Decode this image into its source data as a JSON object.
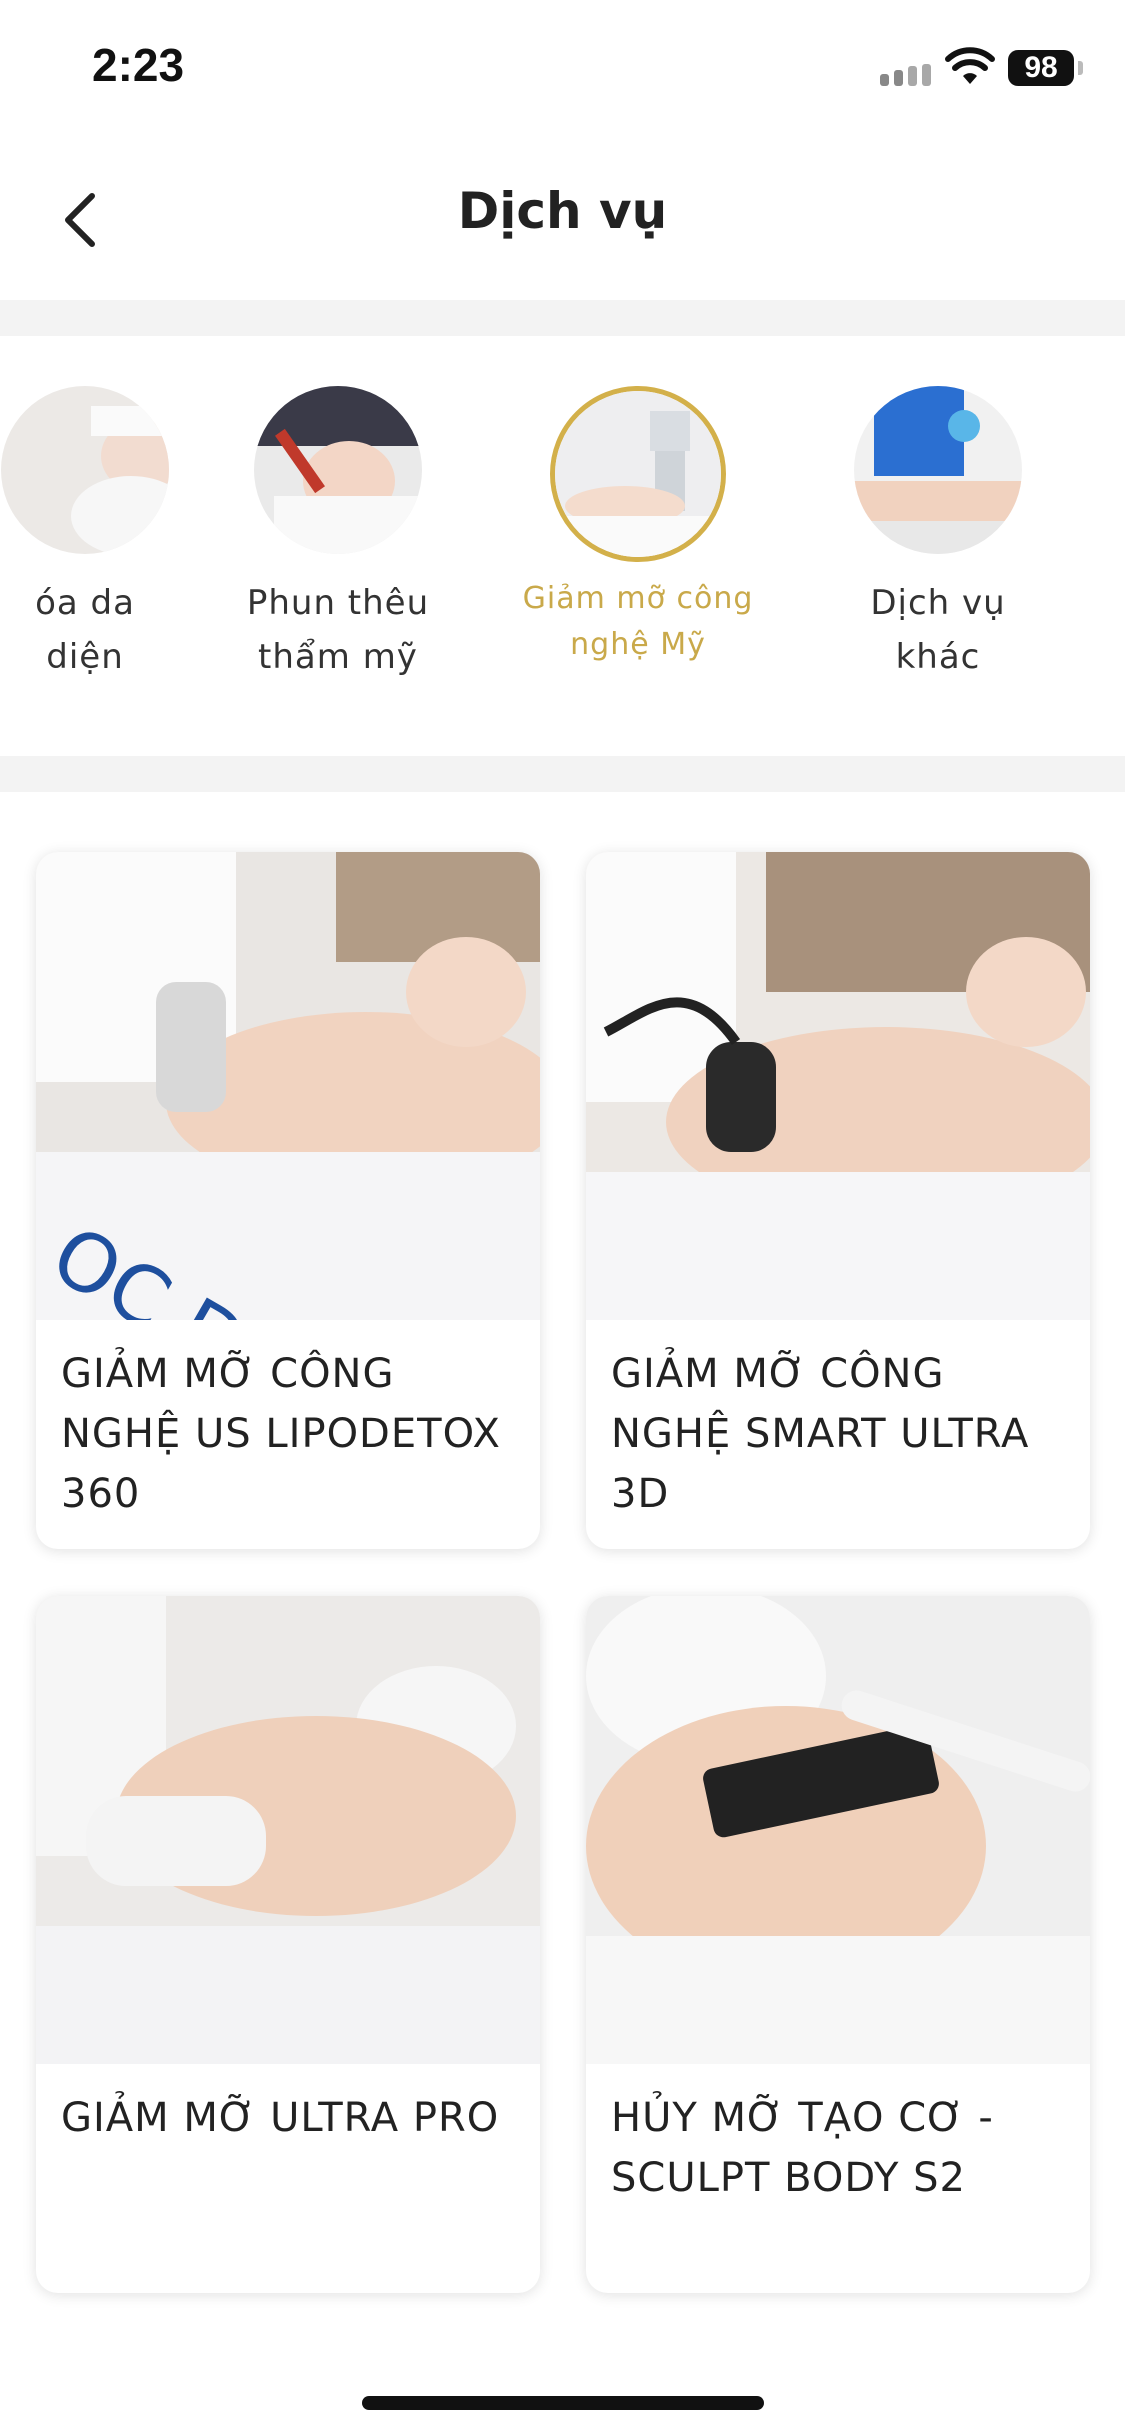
{
  "status_bar": {
    "time": "2:23",
    "battery": "98"
  },
  "nav": {
    "title": "Dịch vụ"
  },
  "categories": [
    {
      "label_line1": "óa da",
      "label_line2": "diện",
      "active": false,
      "icon": "facial-care-photo"
    },
    {
      "label_line1": "Phun thêu",
      "label_line2": "thẩm mỹ",
      "active": false,
      "icon": "cosmetic-tattoo-photo"
    },
    {
      "label_line1": "Giảm mỡ công",
      "label_line2": "nghệ Mỹ",
      "active": true,
      "icon": "fat-reduction-photo"
    },
    {
      "label_line1": "Dịch vụ",
      "label_line2": "khác",
      "active": false,
      "icon": "other-services-photo"
    }
  ],
  "services": [
    {
      "title": "GIẢM MỠ CÔNG NGHỆ US LIPODETOX 360"
    },
    {
      "title": "GIẢM MỠ CÔNG NGHỆ SMART ULTRA 3D"
    },
    {
      "title": "GIẢM MỠ ULTRA PRO"
    },
    {
      "title": "HỦY MỠ TẠO CƠ - SCULPT BODY S2"
    }
  ],
  "colors": {
    "accent": "#c9a94a",
    "band": "#f3f3f3"
  }
}
